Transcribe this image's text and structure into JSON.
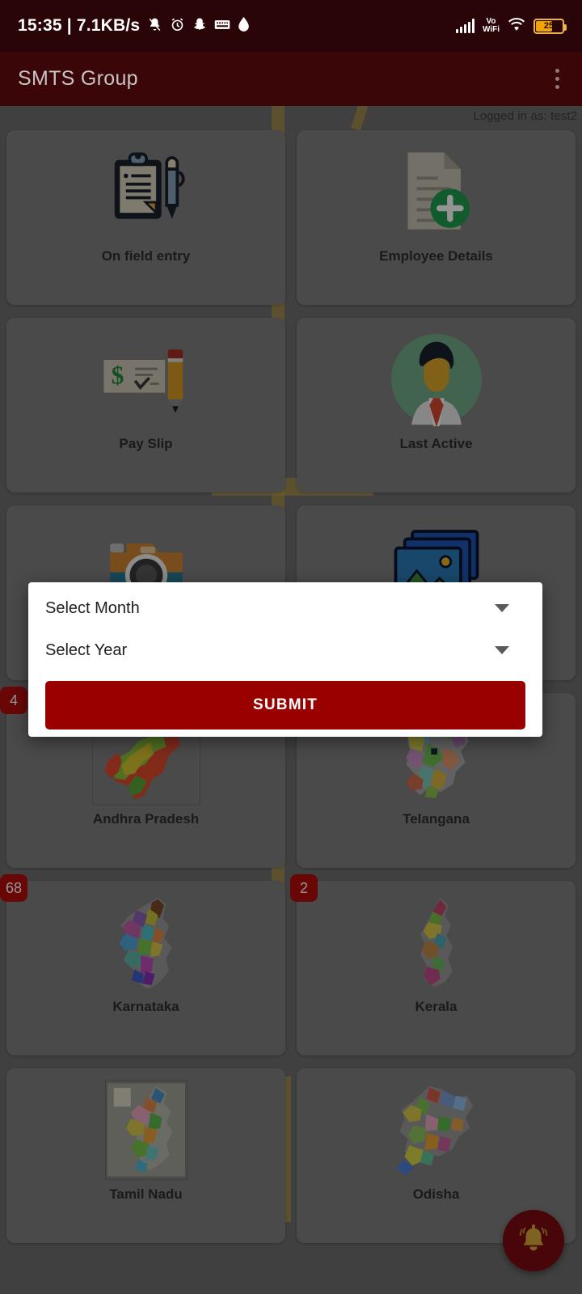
{
  "status_bar": {
    "clock": "15:35 | 7.1KB/s",
    "left_icons": [
      "silent-bell-icon",
      "alarm-icon",
      "snapchat-icon",
      "keyboard-icon",
      "water-drop-icon"
    ],
    "network_label": "Vo\nWiFi",
    "volte_line1": "Vo",
    "volte_line2": "WiFi",
    "right_icons": [
      "signal-bars-icon",
      "volte-wifi-icon",
      "wifi-icon",
      "battery-icon"
    ],
    "battery_level": "25"
  },
  "app_bar": {
    "title": "SMTS Group",
    "overflow_icon": "more-vertical-icon"
  },
  "header": {
    "logged_in_as": "Logged in as: test2"
  },
  "colors": {
    "app_bar": "#3a0608",
    "status_bar": "#2a0507",
    "submit": "#990000",
    "badge": "#b50d0d",
    "fab": "#7d0c12",
    "card": "#808080",
    "page": "#6e6e6e",
    "battery_accent": "#f0a500"
  },
  "grid": {
    "cards": [
      {
        "label": "On field entry",
        "icon": "clipboard-pen-icon",
        "badge": null
      },
      {
        "label": "Employee Details",
        "icon": "document-add-icon",
        "badge": null
      },
      {
        "label": "Pay Slip",
        "icon": "cheque-pencil-icon",
        "badge": null
      },
      {
        "label": "Last Active",
        "icon": "person-avatar-icon",
        "badge": null
      },
      {
        "label": "",
        "icon": "camera-icon",
        "badge": null
      },
      {
        "label": "",
        "icon": "photo-gallery-icon",
        "badge": null
      },
      {
        "label": "Andhra Pradesh",
        "icon": "map-andhra-pradesh",
        "badge": "4"
      },
      {
        "label": "Telangana",
        "icon": "map-telangana",
        "badge": null
      },
      {
        "label": "Karnataka",
        "icon": "map-karnataka",
        "badge": "68"
      },
      {
        "label": "Kerala",
        "icon": "map-kerala",
        "badge": "2"
      },
      {
        "label": "Tamil Nadu",
        "icon": "map-tamil-nadu",
        "badge": null
      },
      {
        "label": "Odisha",
        "icon": "map-odisha",
        "badge": null
      }
    ]
  },
  "fab": {
    "icon": "bell-icon"
  },
  "dialog": {
    "month_label": "Select Month",
    "year_label": "Select Year",
    "submit_label": "SUBMIT",
    "dropdown_icon": "chevron-down-icon"
  }
}
